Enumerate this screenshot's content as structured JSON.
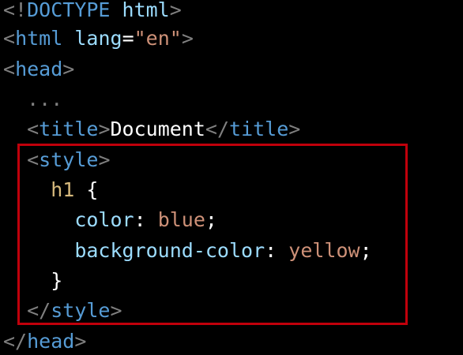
{
  "code": {
    "doctype": {
      "open": "<!",
      "keyword": "DOCTYPE",
      "name": "html",
      "close": ">"
    },
    "html_open": {
      "open": "<",
      "tag": "html",
      "attr": "lang",
      "eq": "=",
      "value": "\"en\"",
      "close": ">"
    },
    "head_open": {
      "open": "<",
      "tag": "head",
      "close": ">"
    },
    "ellipsis": "...",
    "title_line": {
      "open": "<",
      "tag": "title",
      "close": ">",
      "text": "Document",
      "end_open": "</",
      "end_tag": "title",
      "end_close": ">"
    },
    "style_open": {
      "open": "<",
      "tag": "style",
      "close": ">"
    },
    "selector_line": {
      "selector": "h1",
      "brace": "{"
    },
    "color_decl": {
      "prop": "color",
      "colon": ":",
      "value": "blue",
      "semi": ";"
    },
    "bg_decl": {
      "prop": "background-color",
      "colon": ":",
      "value": "yellow",
      "semi": ";"
    },
    "close_brace": "}",
    "style_close": {
      "open": "</",
      "tag": "style",
      "close": ">"
    },
    "head_close": {
      "open": "</",
      "tag": "head",
      "close": ">"
    }
  },
  "highlight": {
    "color": "#c0000b"
  },
  "colors": {
    "background": "#000000",
    "tag": "#569cd6",
    "attribute": "#9cdcfe",
    "string": "#ce9178",
    "punctuation": "#808080",
    "selector": "#d7ba7d"
  }
}
